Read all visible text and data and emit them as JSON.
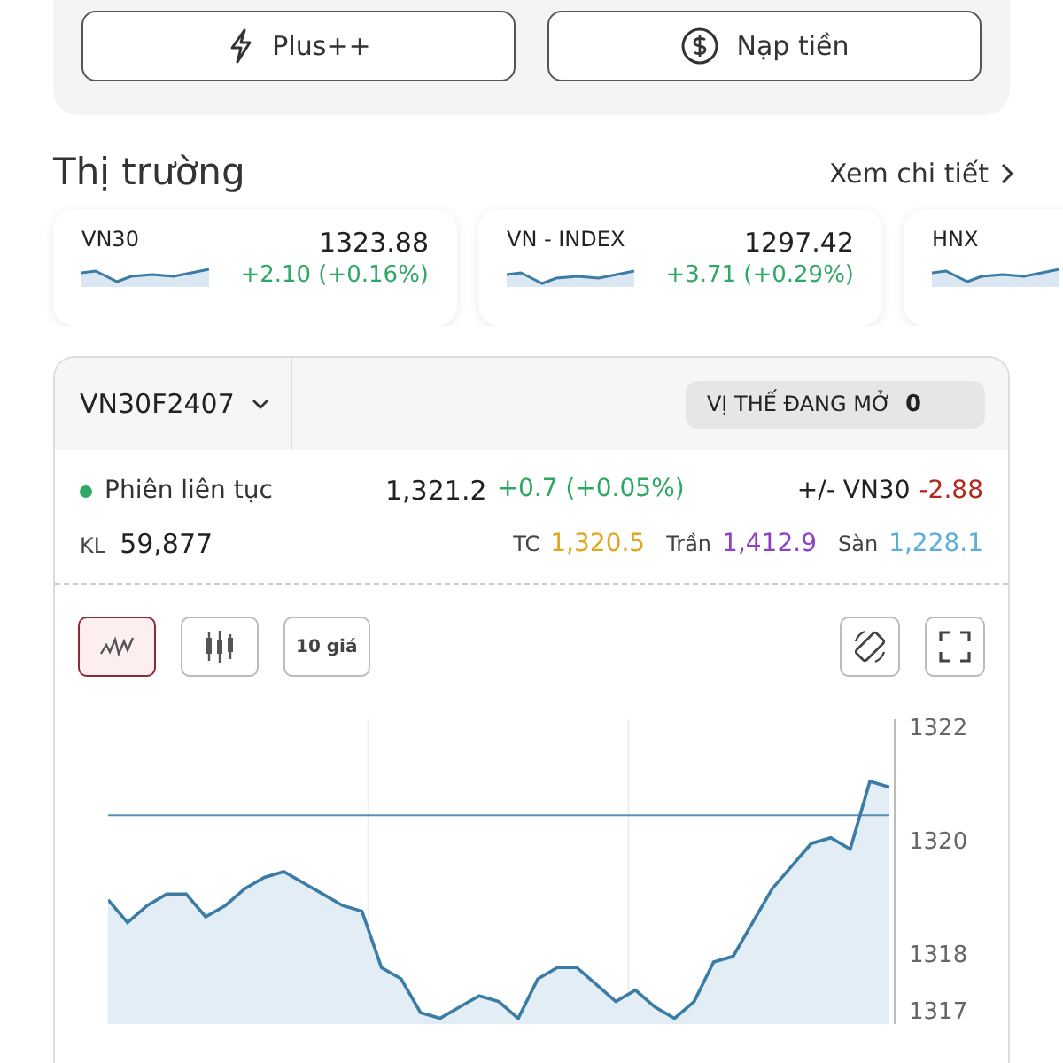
{
  "actions": [
    {
      "label": "Plus++"
    },
    {
      "label": "Nạp tiền"
    }
  ],
  "market": {
    "title": "Thị trường",
    "link": "Xem chi tiết",
    "indices": [
      {
        "name": "VN30",
        "value": "1323.88",
        "change": "+2.10 (+0.16%)",
        "color": "#2ea864"
      },
      {
        "name": "VN - INDEX",
        "value": "1297.42",
        "change": "+3.71 (+0.29%)",
        "color": "#2ea864"
      },
      {
        "name": "HNX"
      }
    ]
  },
  "contract": {
    "symbol": "VN30F2407",
    "open_positions": {
      "label": "VỊ THẾ ĐANG MỞ",
      "value": "0"
    },
    "session": {
      "label": "Phiên liên tục",
      "color": "#2ea864"
    },
    "price": "1,321.2",
    "change": {
      "text": "+0.7 (+0.05%)",
      "color": "#2ea864"
    },
    "basis": {
      "label": "+/- VN30",
      "value": "-2.88",
      "color": "#b3261e"
    },
    "volume": {
      "label": "KL",
      "value": "59,877"
    },
    "ref_prices": [
      {
        "label": "TC",
        "value": "1,320.5",
        "color": "#e0a820"
      },
      {
        "label": "Trần",
        "value": "1,412.9",
        "color": "#8e3fc9"
      },
      {
        "label": "Sàn",
        "value": "1,228.1",
        "color": "#5aaed8"
      }
    ]
  },
  "toolbar": [
    {
      "kind": "line",
      "selected": true
    },
    {
      "kind": "candle",
      "selected": false
    },
    {
      "kind": "text",
      "label": "10 giá",
      "selected": false
    }
  ],
  "chart_data": {
    "type": "area",
    "ylim": [
      1316.8,
      1322.2
    ],
    "yticks": [
      1317,
      1318,
      1320,
      1322
    ],
    "series": [
      {
        "color": "#3a7ca5",
        "values": [
          1319.0,
          1318.6,
          1318.9,
          1319.1,
          1319.1,
          1318.7,
          1318.9,
          1319.2,
          1319.4,
          1319.5,
          1319.3,
          1319.1,
          1318.9,
          1318.8,
          1317.8,
          1317.6,
          1317.0,
          1316.9,
          1317.1,
          1317.3,
          1317.2,
          1316.9,
          1317.6,
          1317.8,
          1317.8,
          1317.5,
          1317.2,
          1317.4,
          1317.1,
          1316.9,
          1317.2,
          1317.9,
          1318.0,
          1318.6,
          1319.2,
          1319.6,
          1320.0,
          1320.1,
          1319.9,
          1321.1,
          1321.0
        ]
      },
      {
        "type": "line",
        "color": "#5a8fb5",
        "values": [
          1320.5,
          1320.5,
          1320.5,
          1320.5,
          1320.5,
          1320.5,
          1320.5,
          1320.5,
          1320.5,
          1320.5,
          1320.5,
          1320.5,
          1320.5,
          1320.5,
          1320.5,
          1320.5,
          1320.5,
          1320.5,
          1320.5,
          1320.5,
          1320.5,
          1320.5,
          1320.5,
          1320.5,
          1320.5,
          1320.5,
          1320.5,
          1320.5,
          1320.5,
          1320.5,
          1320.5,
          1320.5,
          1320.5,
          1320.5,
          1320.5,
          1320.5,
          1320.5,
          1320.5,
          1320.5,
          1320.5,
          1320.5
        ]
      }
    ]
  }
}
